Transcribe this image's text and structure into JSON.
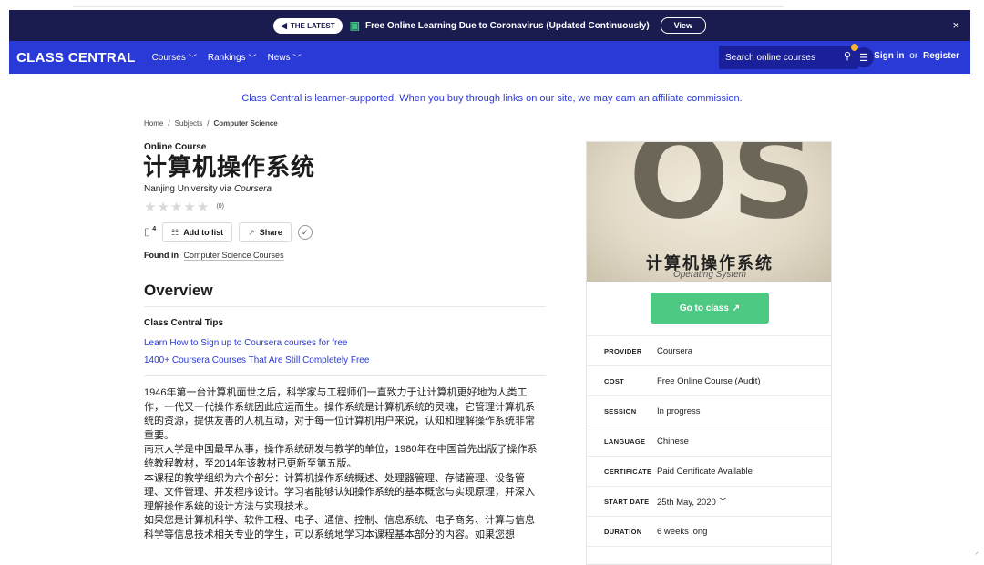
{
  "banner": {
    "badge": "THE LATEST",
    "message": "Free Online Learning Due to Coronavirus (Updated Continuously)",
    "view_label": "View",
    "close": "×"
  },
  "nav": {
    "logo": "CLASS CENTRAL",
    "items": [
      {
        "label": "Courses"
      },
      {
        "label": "Rankings"
      },
      {
        "label": "News"
      }
    ],
    "search_placeholder": "Search online courses",
    "sign_in": "Sign in",
    "or": "or",
    "register": "Register"
  },
  "affiliate_notice": "Class Central is learner-supported. When you buy through links on our site, we may earn an affiliate commission.",
  "breadcrumb": {
    "home": "Home",
    "subjects": "Subjects",
    "current": "Computer Science"
  },
  "course": {
    "type": "Online Course",
    "title": "计算机操作系统",
    "provider_prefix": "Nanjing University via",
    "platform": "Coursera",
    "rating_count": "(0)",
    "bookmark_count": "4",
    "add_to_list": "Add to list",
    "share": "Share",
    "found_in_label": "Found in",
    "found_in_link": "Computer Science Courses"
  },
  "overview": {
    "heading": "Overview",
    "tips_heading": "Class Central Tips",
    "tips": [
      "Learn How to Sign up to Coursera courses for free",
      "1400+ Coursera Courses That Are Still Completely Free"
    ],
    "description": [
      "1946年第一台计算机面世之后，科学家与工程师们一直致力于让计算机更好地为人类工作，一代又一代操作系统因此应运而生。操作系统是计算机系统的灵魂，它管理计算机系统的资源，提供友善的人机互动，对于每一位计算机用户来说，认知和理解操作系统非常重要。",
      "南京大学是中国最早从事，操作系统研发与教学的单位，1980年在中国首先出版了操作系统教程教材，至2014年该教材已更新至第五版。",
      "本课程的教学组织为六个部分：计算机操作系统概述、处理器管理、存储管理、设备管理、文件管理、并发程序设计。学习者能够认知操作系统的基本概念与实现原理，并深入理解操作系统的设计方法与实现技术。",
      "如果您是计算机科学、软件工程、电子、通信、控制、信息系统、电子商务、计算与信息科学等信息技术相关专业的学生，可以系统地学习本课程基本部分的内容。如果您想"
    ]
  },
  "sidebar": {
    "cover_letters": "OS",
    "cover_title": "计算机操作系统",
    "cover_subtitle": "Operating System",
    "go_to_class": "Go to class",
    "details": [
      {
        "key": "PROVIDER",
        "value": "Coursera"
      },
      {
        "key": "COST",
        "value": "Free Online Course (Audit)"
      },
      {
        "key": "SESSION",
        "value": "In progress"
      },
      {
        "key": "LANGUAGE",
        "value": "Chinese"
      },
      {
        "key": "CERTIFICATE",
        "value": "Paid Certificate Available"
      },
      {
        "key": "START DATE",
        "value": "25th May, 2020"
      },
      {
        "key": "DURATION",
        "value": "6 weeks long"
      }
    ]
  },
  "colors": {
    "nav": "#2a3ad6",
    "banner": "#1a1b4f",
    "cta": "#4ec984",
    "link": "#2a3ad6"
  }
}
